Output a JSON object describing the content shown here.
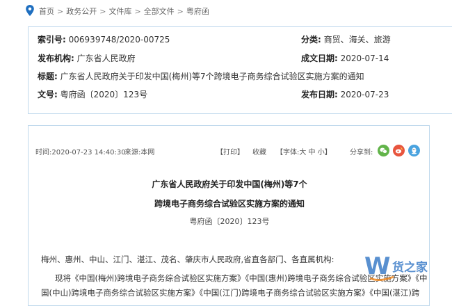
{
  "breadcrumb": {
    "items": [
      "首页",
      "政务公开",
      "文件库",
      "全部文件",
      "粤府函"
    ],
    "separator": ">"
  },
  "meta": {
    "index_label": "索引号:",
    "index_value": "006939748/2020-00725",
    "category_label": "分类:",
    "category_value": "商贸、海关、旅游",
    "issuer_label": "发布机构:",
    "issuer_value": "广东省人民政府",
    "date_made_label": "成文日期:",
    "date_made_value": "2020-07-14",
    "title_label": "标题:",
    "title_value": "广东省人民政府关于印发中国(梅州)等7个跨境电子商务综合试验区实施方案的通知",
    "docno_label": "文号:",
    "docno_value": "粤府函〔2020〕123号",
    "pub_date_label": "发布日期:",
    "pub_date_value": "2020-07-23"
  },
  "article": {
    "time": "时间:2020-07-23 14:40:30",
    "source": "来源:本网",
    "print_label": "【打印】",
    "collect_label": "收藏",
    "font_label": "【字体:大  中  小】",
    "share_label": "分享到:",
    "title_line1": "广东省人民政府关于印发中国(梅州)等7个",
    "title_line2": "跨境电子商务综合试验区实施方案的通知",
    "doc_number": "粤府函〔2020〕123号",
    "addressee": "梅州、惠州、中山、江门、湛江、茂名、肇庆市人民政府,省直各部门、各直属机构:",
    "para_line1": "现将《中国(梅州)跨境电子商务综合试验区实施方案》《中国(惠州)跨境电子商务综合试验区实施方案》《中",
    "para_line2": "国(中山)跨境电子商务综合试验区实施方案》《中国(江门)跨境电子商务综合试验区实施方案》《中国(湛江)跨"
  },
  "share_icons": [
    "wechat-icon",
    "weibo-icon",
    "qq-icon"
  ],
  "colors": {
    "border": "#bfd8ec",
    "wechat": "#62b44a",
    "weibo": "#e8553e",
    "qq": "#4aa3df",
    "logo_blue": "#3c7cc8",
    "logo_orange": "#f08c28"
  },
  "logo": {
    "letter": "W",
    "text": "货之家"
  }
}
